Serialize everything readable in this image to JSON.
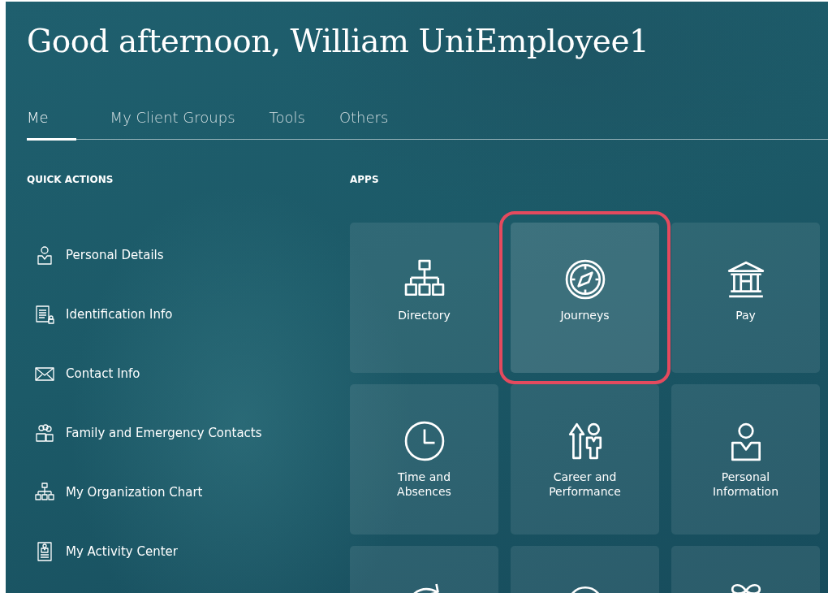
{
  "greeting": "Good afternoon, William UniEmployee1",
  "tabs": [
    {
      "label": "Me",
      "selected": true
    },
    {
      "label": "My Client Groups",
      "selected": false
    },
    {
      "label": "Tools",
      "selected": false
    },
    {
      "label": "Others",
      "selected": false
    }
  ],
  "quick_actions": {
    "heading": "QUICK ACTIONS",
    "items": [
      {
        "label": "Personal Details",
        "kind": "person"
      },
      {
        "label": "Identification Info",
        "kind": "document"
      },
      {
        "label": "Contact Info",
        "kind": "envelope"
      },
      {
        "label": "Family and Emergency Contacts",
        "kind": "group"
      },
      {
        "label": "My Organization Chart",
        "kind": "org"
      },
      {
        "label": "My Activity Center",
        "kind": "badge"
      }
    ]
  },
  "apps": {
    "heading": "APPS",
    "tiles": [
      {
        "label": "Directory",
        "kind": "org",
        "highlighted": false
      },
      {
        "label": "Journeys",
        "kind": "compass",
        "highlighted": true
      },
      {
        "label": "Pay",
        "kind": "bank",
        "highlighted": false
      },
      {
        "label": "Time and Absences",
        "kind": "clock",
        "highlighted": false
      },
      {
        "label": "Career and Performance",
        "kind": "career",
        "highlighted": false
      },
      {
        "label": "Personal Information",
        "kind": "person",
        "highlighted": false
      },
      {
        "kind": "arrow",
        "highlighted": false
      },
      {
        "kind": "circle",
        "highlighted": false
      },
      {
        "kind": "gift",
        "highlighted": false
      }
    ]
  }
}
